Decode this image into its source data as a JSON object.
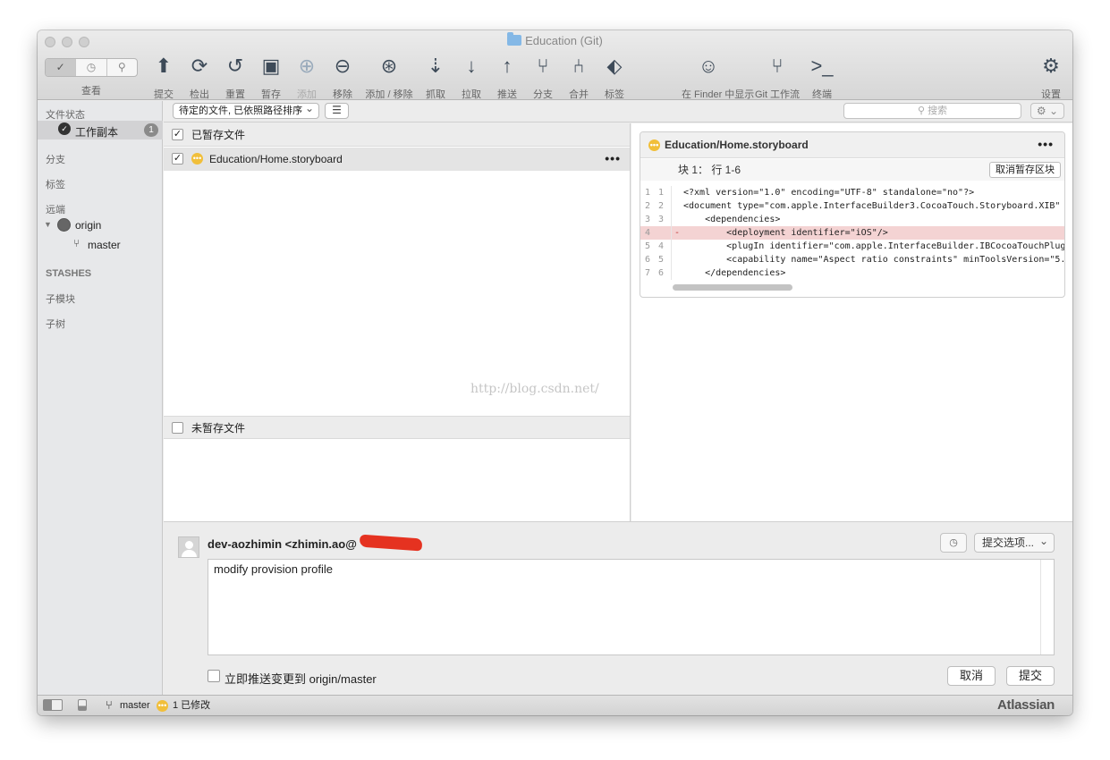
{
  "window": {
    "title": "Education (Git)"
  },
  "toolbar": {
    "view_label": "查看",
    "view_segments": [
      "✓",
      "◷",
      "⚲"
    ],
    "items": [
      {
        "label": "提交",
        "icon": "commit-icon",
        "glyph": "⬆",
        "enabled": true
      },
      {
        "label": "检出",
        "icon": "checkout-icon",
        "glyph": "⟳",
        "enabled": true
      },
      {
        "label": "重置",
        "icon": "reset-icon",
        "glyph": "↺",
        "enabled": true
      },
      {
        "label": "暂存",
        "icon": "stash-icon",
        "glyph": "▣",
        "enabled": true
      },
      {
        "label": "添加",
        "icon": "add-icon",
        "glyph": "⊕",
        "enabled": false
      },
      {
        "label": "移除",
        "icon": "remove-icon",
        "glyph": "⊖",
        "enabled": true
      },
      {
        "label": "添加 / 移除",
        "icon": "add-remove-icon",
        "glyph": "⊛",
        "enabled": true
      },
      {
        "label": "抓取",
        "icon": "fetch-icon",
        "glyph": "⇣",
        "enabled": true
      },
      {
        "label": "拉取",
        "icon": "pull-icon",
        "glyph": "↓",
        "enabled": true
      },
      {
        "label": "推送",
        "icon": "push-icon",
        "glyph": "↑",
        "enabled": true
      },
      {
        "label": "分支",
        "icon": "branch-icon",
        "glyph": "⑂",
        "enabled": true
      },
      {
        "label": "合并",
        "icon": "merge-icon",
        "glyph": "⑃",
        "enabled": true
      },
      {
        "label": "标签",
        "icon": "tag-icon",
        "glyph": "⬖",
        "enabled": true
      },
      {
        "label": "在 Finder 中显示",
        "icon": "finder-icon",
        "glyph": "☺",
        "enabled": true
      },
      {
        "label": "Git 工作流",
        "icon": "git-flow-icon",
        "glyph": "⑂",
        "enabled": true
      },
      {
        "label": "终端",
        "icon": "terminal-icon",
        "glyph": ">_",
        "enabled": true
      },
      {
        "label": "设置",
        "icon": "gear-icon",
        "glyph": "⚙",
        "enabled": true
      }
    ]
  },
  "sidebar": {
    "file_status": "文件状态",
    "working_copy": "工作副本",
    "working_copy_badge": "1",
    "branches": "分支",
    "tags": "标签",
    "remotes": "远端",
    "remote_name": "origin",
    "remote_branch": "master",
    "stashes": "STASHES",
    "submodules": "子模块",
    "subtrees": "子树"
  },
  "filterbar": {
    "sort_option": "待定的文件, 已依照路径排序",
    "search_placeholder": "搜索"
  },
  "files": {
    "staged_header": "已暂存文件",
    "staged": [
      {
        "path": "Education/Home.storyboard",
        "status": "modified"
      }
    ],
    "unstaged_header": "未暂存文件"
  },
  "diff": {
    "file": "Education/Home.storyboard",
    "hunk_label": "块 1： 行 1-6",
    "unstage_hunk": "取消暂存区块",
    "lines": [
      {
        "old": "1",
        "new": "1",
        "mark": "",
        "type": "ctx",
        "text": "<?xml version=\"1.0\" encoding=\"UTF-8\" standalone=\"no\"?>"
      },
      {
        "old": "2",
        "new": "2",
        "mark": "",
        "type": "ctx",
        "text": "<document type=\"com.apple.InterfaceBuilder3.CocoaTouch.Storyboard.XIB\""
      },
      {
        "old": "3",
        "new": "3",
        "mark": "",
        "type": "ctx",
        "text": "    <dependencies>"
      },
      {
        "old": "4",
        "new": "",
        "mark": "-",
        "type": "del",
        "text": "        <deployment identifier=\"iOS\"/>"
      },
      {
        "old": "5",
        "new": "4",
        "mark": "",
        "type": "ctx",
        "text": "        <plugIn identifier=\"com.apple.InterfaceBuilder.IBCocoaTouchPlug"
      },
      {
        "old": "6",
        "new": "5",
        "mark": "",
        "type": "ctx",
        "text": "        <capability name=\"Aspect ratio constraints\" minToolsVersion=\"5."
      },
      {
        "old": "7",
        "new": "6",
        "mark": "",
        "type": "ctx",
        "text": "    </dependencies>"
      }
    ]
  },
  "watermark": "http://blog.csdn.net/",
  "commit": {
    "author": "dev-aozhimin <zhimin.ao@",
    "options": "提交选项...",
    "message": "modify provision profile",
    "push_label": "立即推送变更到 origin/master",
    "cancel": "取消",
    "submit": "提交"
  },
  "statusbar": {
    "branch": "master",
    "changes": "1 已修改",
    "brand": "Atlassian"
  }
}
